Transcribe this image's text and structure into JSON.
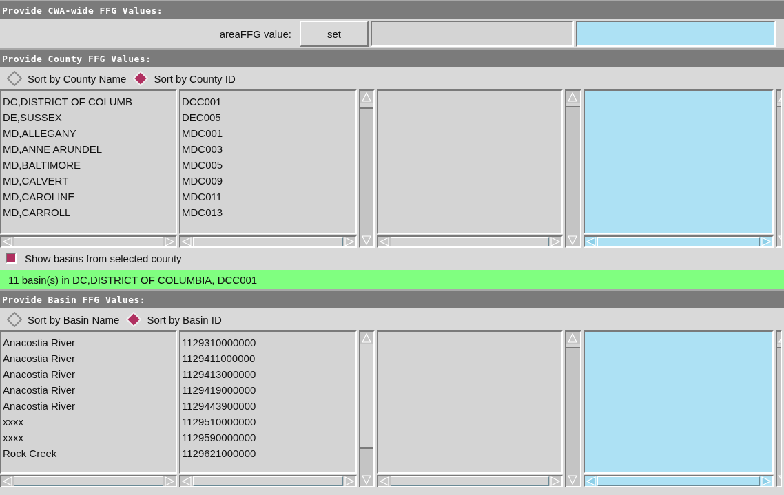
{
  "cwa": {
    "header": "Provide CWA-wide FFG Values:",
    "label": "areaFFG value:",
    "button": "set"
  },
  "county": {
    "header": "Provide County FFG Values:",
    "sort_options": [
      {
        "label": "Sort by County Name",
        "selected": false
      },
      {
        "label": "Sort by County ID",
        "selected": true
      }
    ],
    "rows": [
      {
        "name": "DC,DISTRICT OF COLUMB",
        "id": "DCC001"
      },
      {
        "name": "DE,SUSSEX",
        "id": "DEC005"
      },
      {
        "name": "MD,ALLEGANY",
        "id": "MDC001"
      },
      {
        "name": "MD,ANNE ARUNDEL",
        "id": "MDC003"
      },
      {
        "name": "MD,BALTIMORE",
        "id": "MDC005"
      },
      {
        "name": "MD,CALVERT",
        "id": "MDC009"
      },
      {
        "name": "MD,CAROLINE",
        "id": "MDC011"
      },
      {
        "name": "MD,CARROLL",
        "id": "MDC013"
      }
    ]
  },
  "show_basins": {
    "label": "Show basins from selected county",
    "checked": true
  },
  "status": "11 basin(s) in DC,DISTRICT OF COLUMBIA, DCC001",
  "basin": {
    "header": "Provide Basin FFG Values:",
    "sort_options": [
      {
        "label": "Sort by Basin Name",
        "selected": false
      },
      {
        "label": "Sort by Basin ID",
        "selected": true
      }
    ],
    "rows": [
      {
        "name": "Anacostia River",
        "id": "1129310000000"
      },
      {
        "name": "Anacostia River",
        "id": "1129411000000"
      },
      {
        "name": "Anacostia River",
        "id": "1129413000000"
      },
      {
        "name": "Anacostia River",
        "id": "1129419000000"
      },
      {
        "name": "Anacostia River",
        "id": "1129443900000"
      },
      {
        "name": "xxxx",
        "id": "1129510000000"
      },
      {
        "name": "xxxx",
        "id": "1129590000000"
      },
      {
        "name": "Rock Creek",
        "id": "1129621000000"
      }
    ]
  }
}
